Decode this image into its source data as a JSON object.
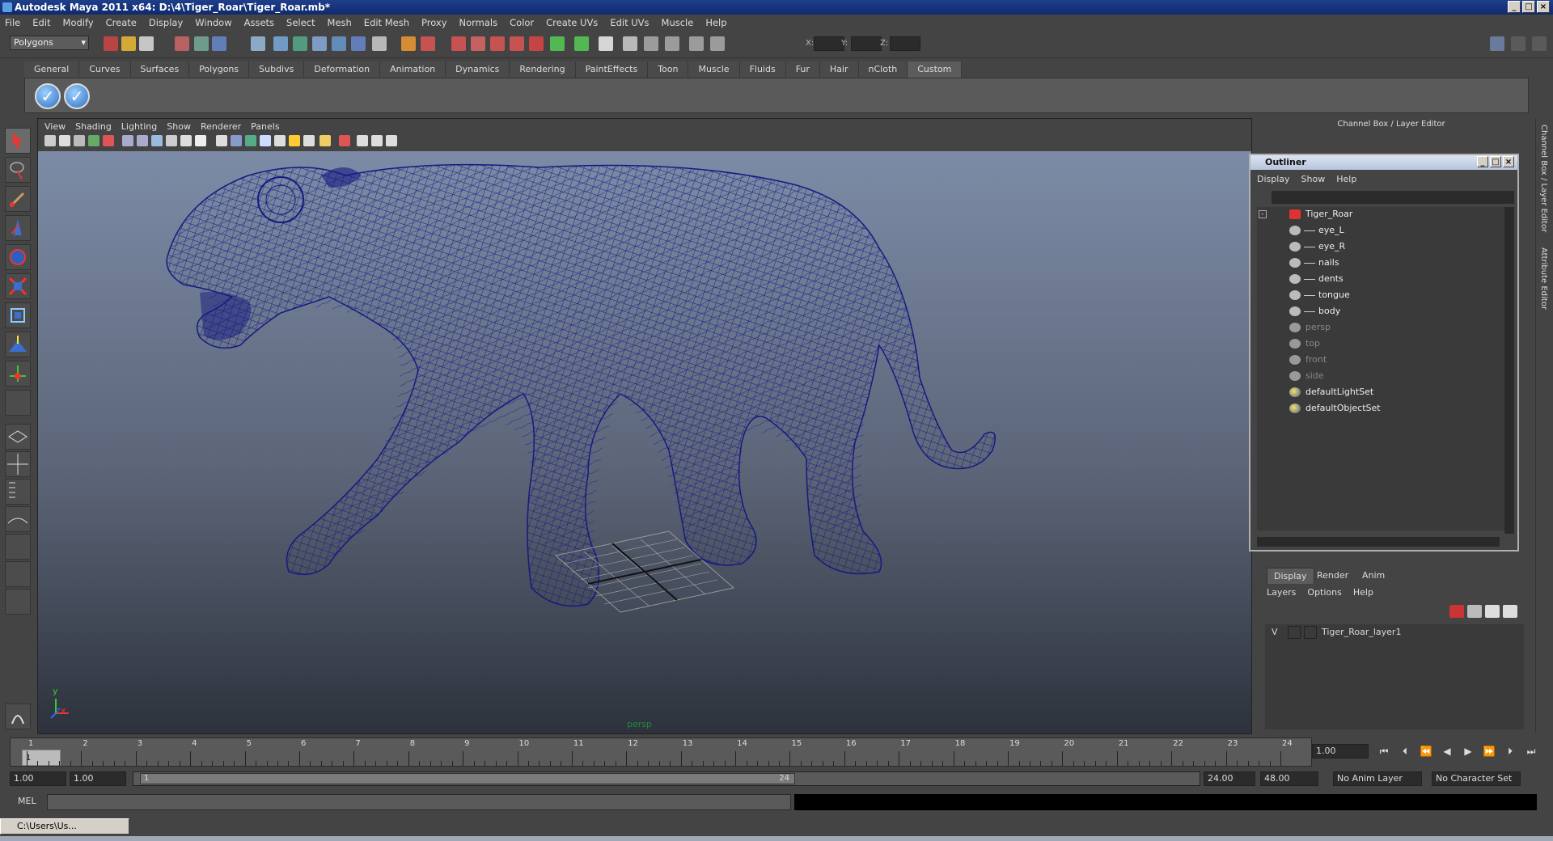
{
  "window": {
    "title": "Autodesk Maya 2011 x64: D:\\4\\Tiger_Roar\\Tiger_Roar.mb*"
  },
  "menubar": {
    "items": [
      "File",
      "Edit",
      "Modify",
      "Create",
      "Display",
      "Window",
      "Assets",
      "Select",
      "Mesh",
      "Edit Mesh",
      "Proxy",
      "Normals",
      "Color",
      "Create UVs",
      "Edit UVs",
      "Muscle",
      "Help"
    ]
  },
  "statusline": {
    "mode": "Polygons",
    "x_label": "X:",
    "y_label": "Y:",
    "z_label": "Z:"
  },
  "shelf": {
    "tabs": [
      "General",
      "Curves",
      "Surfaces",
      "Polygons",
      "Subdivs",
      "Deformation",
      "Animation",
      "Dynamics",
      "Rendering",
      "PaintEffects",
      "Toon",
      "Muscle",
      "Fluids",
      "Fur",
      "Hair",
      "nCloth",
      "Custom"
    ],
    "active": "Custom"
  },
  "viewport": {
    "menu": [
      "View",
      "Shading",
      "Lighting",
      "Show",
      "Renderer",
      "Panels"
    ],
    "camera_label": "persp",
    "axis_y": "y",
    "axis_x": "x",
    "axis_z": "z"
  },
  "channelbox": {
    "header": "Channel Box / Layer Editor"
  },
  "outliner": {
    "title": "Outliner",
    "menu": [
      "Display",
      "Show",
      "Help"
    ],
    "items": [
      {
        "label": "Tiger_Roar",
        "indent": 0,
        "dim": false
      },
      {
        "label": "eye_L",
        "indent": 1,
        "dim": false
      },
      {
        "label": "eye_R",
        "indent": 1,
        "dim": false
      },
      {
        "label": "nails",
        "indent": 1,
        "dim": false
      },
      {
        "label": "dents",
        "indent": 1,
        "dim": false
      },
      {
        "label": "tongue",
        "indent": 1,
        "dim": false
      },
      {
        "label": "body",
        "indent": 1,
        "dim": false
      },
      {
        "label": "persp",
        "indent": 0,
        "dim": true
      },
      {
        "label": "top",
        "indent": 0,
        "dim": true
      },
      {
        "label": "front",
        "indent": 0,
        "dim": true
      },
      {
        "label": "side",
        "indent": 0,
        "dim": true
      },
      {
        "label": "defaultLightSet",
        "indent": 0,
        "dim": false
      },
      {
        "label": "defaultObjectSet",
        "indent": 0,
        "dim": false
      }
    ]
  },
  "layers": {
    "tabs": [
      "Display",
      "Render",
      "Anim"
    ],
    "menu": [
      "Layers",
      "Options",
      "Help"
    ],
    "rows": [
      {
        "visible": "V",
        "name": "Tiger_Roar_layer1"
      }
    ]
  },
  "timeslider": {
    "ticks": [
      "1",
      "2",
      "3",
      "4",
      "5",
      "6",
      "7",
      "8",
      "9",
      "10",
      "11",
      "12",
      "13",
      "14",
      "15",
      "16",
      "17",
      "18",
      "19",
      "20",
      "21",
      "22",
      "23",
      "24"
    ],
    "current_frame_marker": "1",
    "current_frame": "1.00"
  },
  "range": {
    "start": "1.00",
    "playback_start": "1.00",
    "slider_start": "1",
    "slider_end": "24",
    "playback_end": "24.00",
    "end": "48.00",
    "anim_layer": "No Anim Layer",
    "character_set": "No Character Set"
  },
  "cmdline": {
    "label": "MEL"
  },
  "taskbar": {
    "label": "C:\\Users\\Us..."
  },
  "right_tabs": {
    "channel": "Channel Box / Layer Editor",
    "attribute": "Attribute Editor"
  },
  "colors": {
    "wireframe": "#151a80",
    "title_bar": "#1e3f8a",
    "background": "#444444"
  }
}
